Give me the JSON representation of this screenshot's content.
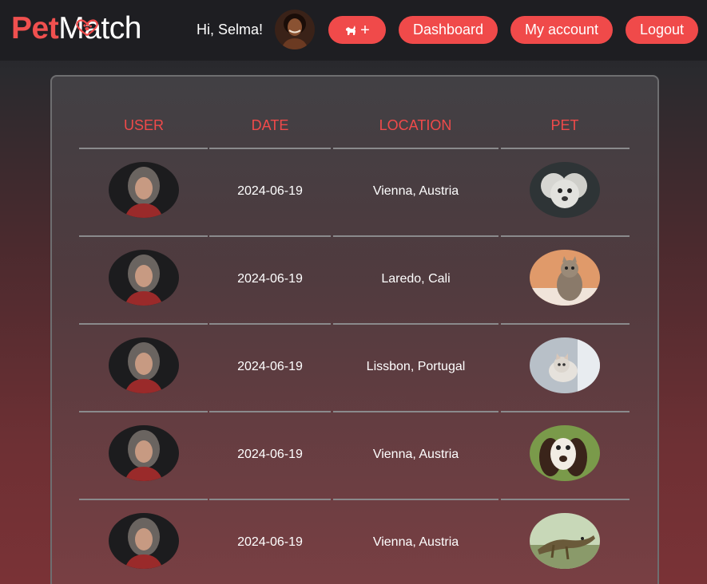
{
  "header": {
    "logo_pet": "Pet",
    "logo_match": "Match",
    "greeting": "Hi, Selma!",
    "add_pet_label": "+",
    "dashboard_label": "Dashboard",
    "account_label": "My account",
    "logout_label": "Logout"
  },
  "table": {
    "columns": [
      "USER",
      "DATE",
      "LOCATION",
      "PET"
    ],
    "rows": [
      {
        "date": "2024-06-19",
        "location": "Vienna, Austria",
        "pet": "poodle"
      },
      {
        "date": "2024-06-19",
        "location": "Laredo, Cali",
        "pet": "tabby-cat"
      },
      {
        "date": "2024-06-19",
        "location": "Lissbon, Portugal",
        "pet": "white-cat"
      },
      {
        "date": "2024-06-19",
        "location": "Vienna, Austria",
        "pet": "spaniel"
      },
      {
        "date": "2024-06-19",
        "location": "Vienna, Austria",
        "pet": "lizard"
      }
    ]
  },
  "colors": {
    "accent": "#f04a4a",
    "header_bg": "#1e1e22"
  }
}
